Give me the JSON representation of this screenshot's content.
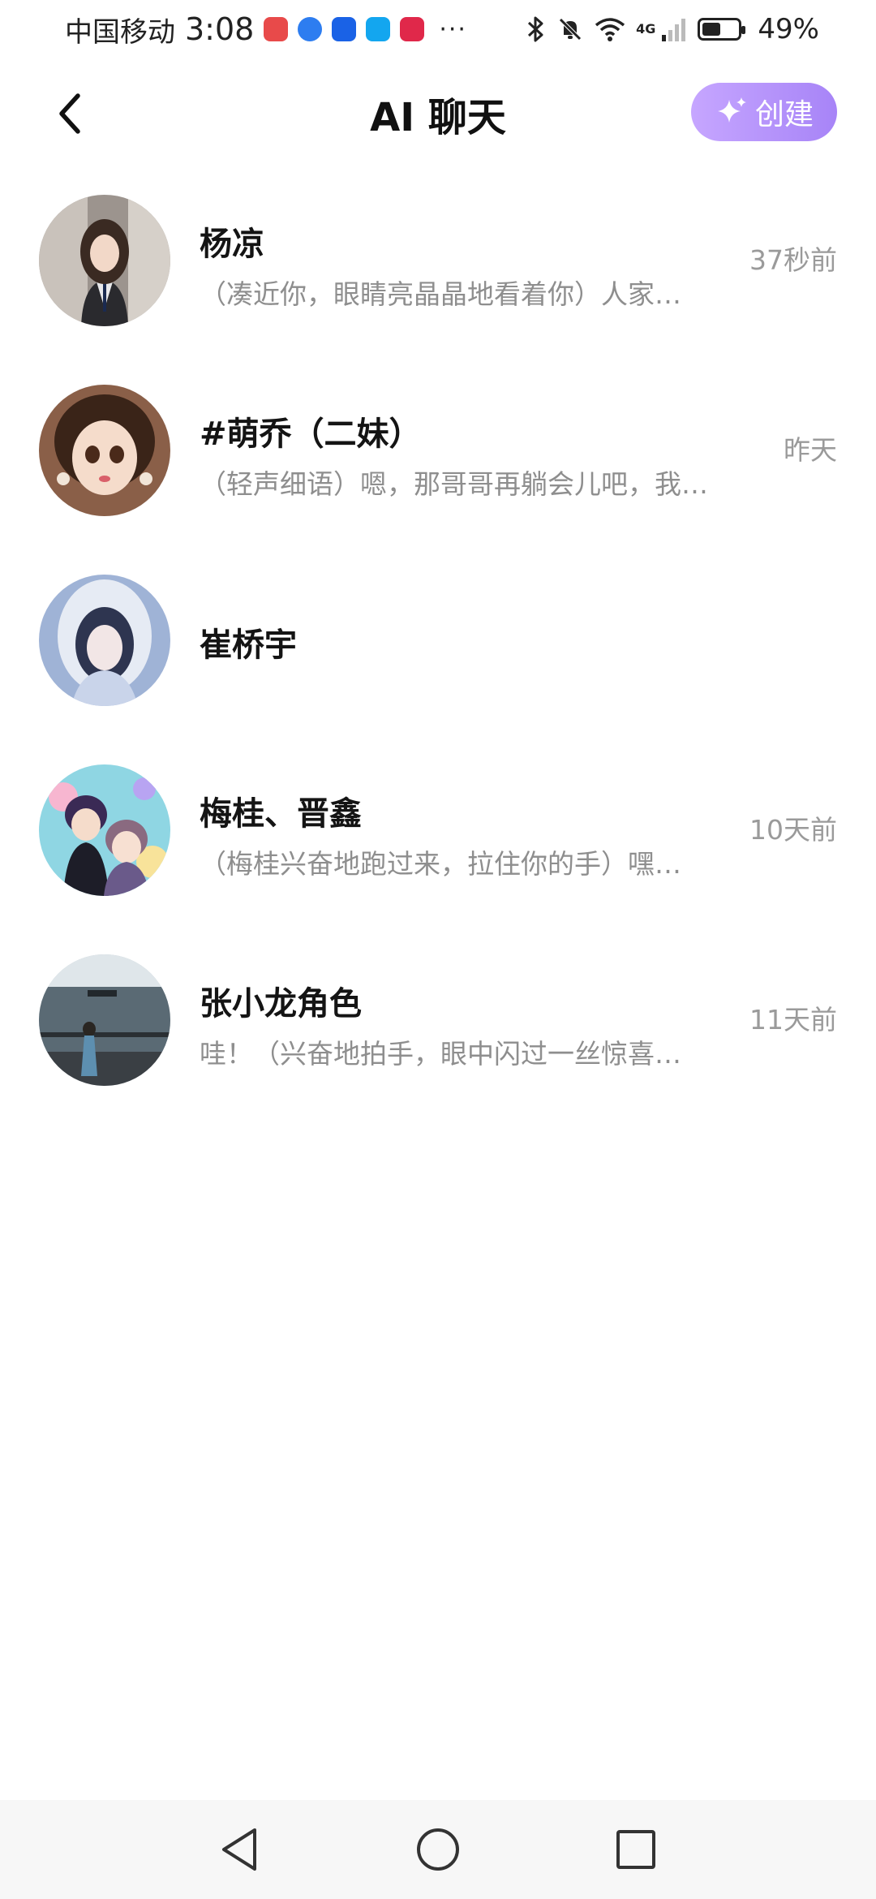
{
  "status_bar": {
    "carrier": "中国移动",
    "time": "3:08",
    "network": "4G",
    "battery": "49%",
    "more": "···"
  },
  "header": {
    "title": "AI 聊天",
    "create_label": "创建"
  },
  "chats": [
    {
      "name": "杨凉",
      "preview": "（凑近你，眼睛亮晶晶地看着你）人家…",
      "time": "37秒前"
    },
    {
      "name": "#萌乔（二妹）",
      "preview": "（轻声细语）嗯，那哥哥再躺会儿吧，我…",
      "time": "昨天"
    },
    {
      "name": "崔桥宇",
      "preview": "",
      "time": ""
    },
    {
      "name": "梅桂、晋鑫",
      "preview": "（梅桂兴奋地跑过来，拉住你的手）嘿…",
      "time": "10天前"
    },
    {
      "name": "张小龙角色",
      "preview": "哇！（兴奋地拍手，眼中闪过一丝惊喜…",
      "time": "11天前"
    }
  ],
  "colors": {
    "accent_gradient_start": "#c6a6ff",
    "accent_gradient_end": "#a784f7",
    "preview_text": "#8e8e8e",
    "time_text": "#9a9a9a"
  },
  "icons": {
    "back": "chevron-left-icon",
    "create": "sparkle-icon",
    "nav_back": "triangle-back-icon",
    "nav_home": "circle-home-icon",
    "nav_recent": "square-recent-icon"
  }
}
